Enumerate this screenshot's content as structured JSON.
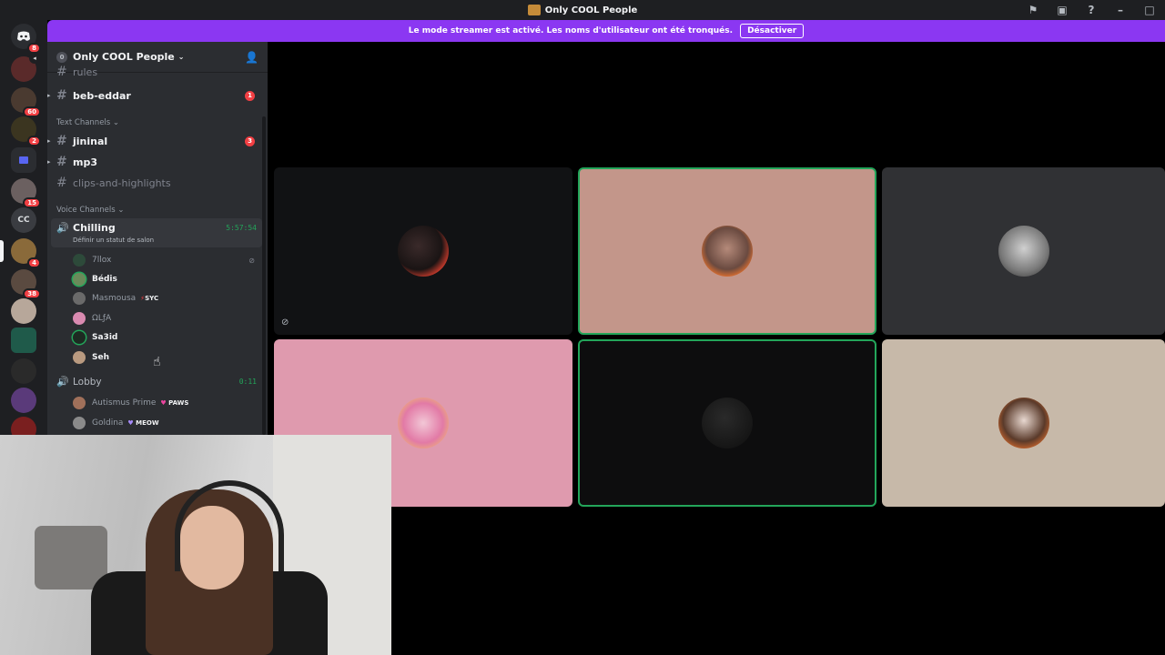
{
  "titlebar": {
    "title": "Only COOL People",
    "icons": [
      "inbox-flag-icon",
      "screen-icon",
      "help-icon",
      "minimize-icon",
      "maximize-icon"
    ]
  },
  "banner": {
    "text": "Le mode streamer est activé. Les noms d'utilisateur ont été tronqués.",
    "button_label": "Désactiver"
  },
  "rail": {
    "badges": [
      "8",
      "60",
      "2",
      "15",
      "4",
      "38"
    ],
    "cc_label": "CC"
  },
  "server": {
    "name": "Only COOL People"
  },
  "channels": {
    "top": [
      {
        "name": "rules"
      },
      {
        "name": "beb-eddar",
        "mentions": "1"
      }
    ],
    "text_category": "Text Channels",
    "text": [
      {
        "name": "jininal",
        "mentions": "3"
      },
      {
        "name": "mp3"
      },
      {
        "name": "clips-and-highlights"
      }
    ],
    "voice_category": "Voice Channels",
    "voice": {
      "name": "Chilling",
      "status": "Définir un statut de salon",
      "timer": "5:57:54",
      "users": [
        {
          "name": "7llox"
        },
        {
          "name": "Bédis"
        },
        {
          "name": "Masmousa",
          "tag": "SYC"
        },
        {
          "name": "ΩLƒA"
        },
        {
          "name": "Sa3id"
        },
        {
          "name": "Seh"
        }
      ]
    },
    "lobby": {
      "name": "Lobby",
      "timer": "0:11",
      "users": [
        {
          "name": "Autismus Prime",
          "tag": "PAWS"
        },
        {
          "name": "Goldina",
          "tag": "MEOW"
        }
      ]
    }
  },
  "colors": {
    "accent_green": "#23a55a",
    "banner_purple": "#8b37f2",
    "mention_red": "#f23f43",
    "tile_pink": "#df9aae",
    "tile_rose": "#c3968a",
    "tile_beige": "#c7b9a9"
  }
}
